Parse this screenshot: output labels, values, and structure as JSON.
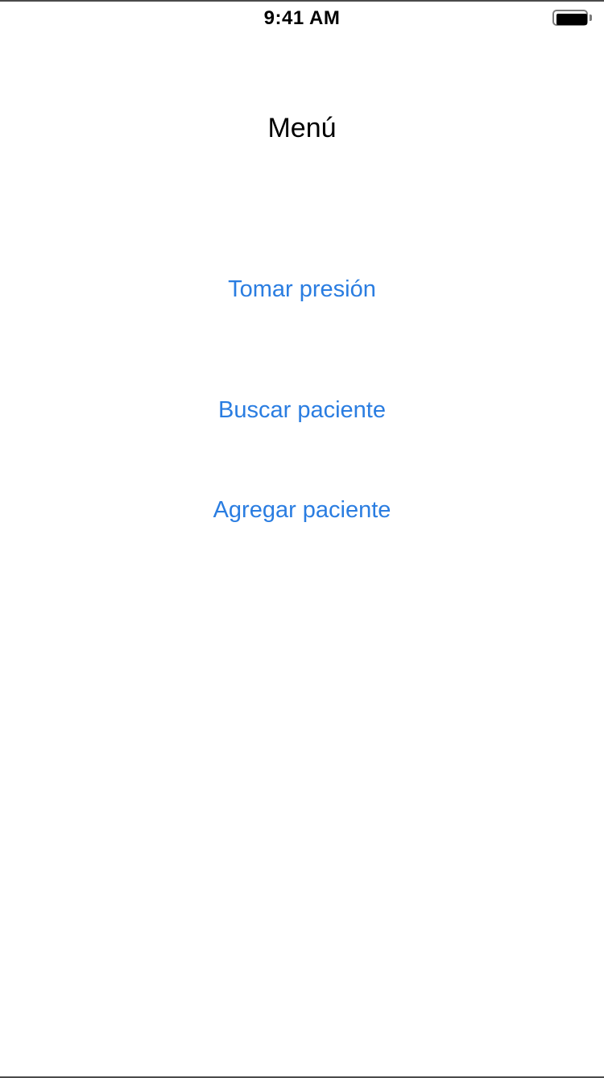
{
  "status_bar": {
    "time": "9:41 AM",
    "battery_level": 1.0
  },
  "screen": {
    "title": "Menú"
  },
  "menu": {
    "items": [
      {
        "label": "Tomar presión"
      },
      {
        "label": "Buscar paciente"
      },
      {
        "label": "Agregar paciente"
      }
    ]
  },
  "colors": {
    "accent": "#2a7de1",
    "text": "#000000",
    "background": "#ffffff"
  },
  "icons": {
    "battery": "battery-icon"
  }
}
